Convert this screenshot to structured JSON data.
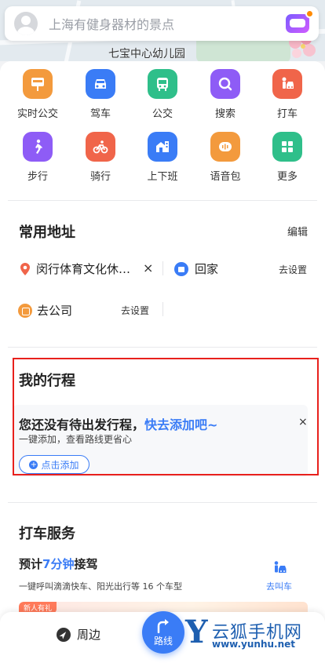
{
  "search": {
    "placeholder": "上海有健身器材的景点"
  },
  "map": {
    "label": "七宝中心幼儿园"
  },
  "grid": [
    {
      "label": "实时公交",
      "icon": "bus-stop-icon",
      "color": "#f39a3d"
    },
    {
      "label": "驾车",
      "icon": "car-icon",
      "color": "#3a7cf6"
    },
    {
      "label": "公交",
      "icon": "bus-icon",
      "color": "#2fbf8a"
    },
    {
      "label": "搜索",
      "icon": "search-icon",
      "color": "#8e5cf6"
    },
    {
      "label": "打车",
      "icon": "taxi-icon",
      "color": "#f0654a"
    },
    {
      "label": "步行",
      "icon": "walk-icon",
      "color": "#8e5cf6"
    },
    {
      "label": "骑行",
      "icon": "bike-icon",
      "color": "#f0654a"
    },
    {
      "label": "上下班",
      "icon": "commute-icon",
      "color": "#3a7cf6"
    },
    {
      "label": "语音包",
      "icon": "voice-icon",
      "color": "#f39a3d"
    },
    {
      "label": "更多",
      "icon": "more-icon",
      "color": "#2fbf8a"
    }
  ],
  "addresses": {
    "title": "常用地址",
    "edit": "编辑",
    "recent": "闵行体育文化休…",
    "close": "×",
    "home": "回家",
    "home_action": "去设置",
    "office": "去公司",
    "office_action": "去设置"
  },
  "trips": {
    "title": "我的行程",
    "empty_text": "您还没有待出发行程，",
    "empty_link": "快去添加吧~",
    "subtitle": "一键添加，查看路线更省心",
    "close": "×",
    "add_button": "点击添加"
  },
  "taxi": {
    "title": "打车服务",
    "eta_prefix": "预计",
    "eta_value": "7分钟",
    "eta_suffix": "接驾",
    "desc": "一键呼叫滴滴快车、阳光出行等 16 个车型",
    "action": "去叫车",
    "banner_tag": "新人有礼"
  },
  "nav": {
    "nearby": "周边",
    "route": "路线"
  },
  "watermark": {
    "letter": "Y",
    "name": "云狐手机网",
    "url": "www.yunhu.net"
  },
  "colors": {
    "accent": "#3a7cf6",
    "highlight_box": "#e8201c"
  }
}
